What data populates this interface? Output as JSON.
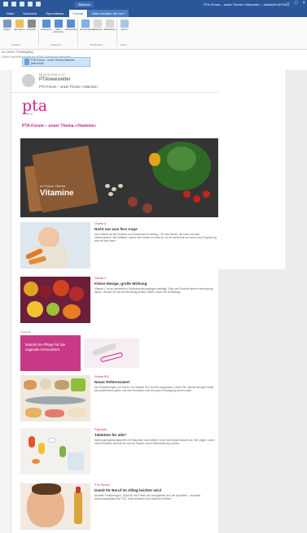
{
  "titlebar": {
    "context_tab": "Bildtools",
    "window_title": "PTA-Forum – unser Thema «Vitamine» – Nachricht (HTML)"
  },
  "tabs": [
    {
      "label": "Datei"
    },
    {
      "label": "Nachricht"
    },
    {
      "label": "Sprechblase"
    },
    {
      "label": "Format"
    },
    {
      "label": "Was möchten Sie tun?"
    }
  ],
  "ribbon": {
    "buttons": [
      {
        "label": "Regel",
        "color": "#7a9ac2"
      },
      {
        "label": "Ignorieren",
        "color": "#e6c25a"
      },
      {
        "label": "Löschen",
        "color": "#8a8a8a"
      },
      {
        "label": "Antworten",
        "color": "#5b8fd1"
      },
      {
        "label": "Allen antworten",
        "color": "#5b8fd1"
      },
      {
        "label": "Weiterleiten",
        "color": "#5b8fd1"
      },
      {
        "label": "Verschieben",
        "color": "#7fb2e5"
      },
      {
        "label": "Markieren",
        "color": "#d8d8d8"
      },
      {
        "label": "Bearbeiten",
        "color": "#d8d8d8"
      },
      {
        "label": "Zoom",
        "color": "#a7c7e7"
      }
    ],
    "groups": [
      "Löschen",
      "Antworten",
      "Verschieben",
      "Zoom"
    ]
  },
  "folder_path": {
    "line1": "Im Ordner “Posteingang”",
    "line2": "Diese Nachricht wurde als HTML-Nachricht gesendet."
  },
  "attachment": {
    "text": "PTA-Forum – unser Thema Vitamine (Nachricht)"
  },
  "message": {
    "date": "Mi 26.09.2018 11:22",
    "sender": "PTAnewsletter",
    "subject": "PTA-Forum – unser Thema «Vitamine»"
  },
  "newsletter": {
    "logo_text": "pta",
    "logo_sub": "FORUM",
    "headline": "PTA-Forum – unser Thema «Vitamine»",
    "hero_kicker": "Im Fokus: Thema",
    "hero_title": "Vitamine",
    "articles": [
      {
        "kicker": "Vitamin A",
        "title": "Nicht nur was fürs Auge",
        "body": "Das Vitamin ist bei Kindern und Erwachsenen wichtig – für das Sehen, die Haut und das Immunsystem. Wir erklären, warum der Körper es braucht, wo es vorkommt und wann eine Ergänzung sinnvoll sein kann."
      },
      {
        "kicker": "Vitamin C",
        "title": "Kleine Menge, große Wirkung",
        "body": "Vitamin C ist an zahlreichen Stoffwechselvorgängen beteiligt. Obst und Gemüse liefern meist genug davon. Worauf Sie bei der Beratung achten sollten, lesen Sie im Beitrag."
      }
    ],
    "ad": {
      "label": "ANZEIGE",
      "text": "Natürliche Pflege für die vaginale Gesundheit"
    },
    "articles2": [
      {
        "kicker": "Vitamin B12",
        "title": "Neuer Referenzwert",
        "body": "Die Empfehlungen zur Zufuhr von Vitamin B12 wurden angepasst. Lesen Sie, welche Mengen heute als ausreichend gelten und wer besonders auf eine gute Versorgung achten sollte."
      },
      {
        "kicker": "Präparate",
        "title": "Tabletten für alle?",
        "body": "Nahrungsergänzungsmittel mit Vitaminen sind beliebt. Doch nicht jeder braucht sie. Wir zeigen, wann eine Einnahme sinnvoll ist und wo Risiken durch Überdosierung drohen."
      },
      {
        "kicker": "PTA-Service",
        "title": "Damit Ihr Beruf im Alltag leichter wird",
        "body": "Aktuelle Fortbildungen, Tipps für die Praxis und Neuigkeiten aus der Apotheke – kompakt zusammengefasst für PTA. Jetzt reinlesen und informiert bleiben."
      }
    ]
  }
}
